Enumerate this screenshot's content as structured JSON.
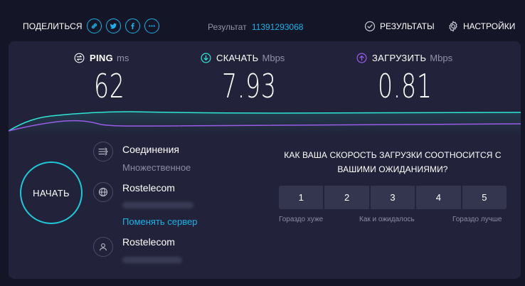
{
  "header": {
    "share_label": "ПОДЕЛИТЬСЯ",
    "share_buttons": [
      "link-icon",
      "twitter-icon",
      "facebook-icon",
      "more-icon"
    ],
    "result_label": "Результат",
    "result_id": "11391293068",
    "results_label": "РЕЗУЛЬТАТЫ",
    "settings_label": "НАСТРОЙКИ"
  },
  "metrics": {
    "ping": {
      "name": "PING",
      "unit": "ms",
      "value": "62",
      "icon": "ping-icon"
    },
    "download": {
      "name": "СКАЧАТЬ",
      "unit": "Mbps",
      "value": "7.93",
      "icon": "download-icon"
    },
    "upload": {
      "name": "ЗАГРУЗИТЬ",
      "unit": "Mbps",
      "value": "0.81",
      "icon": "upload-icon"
    }
  },
  "start_label": "НАЧАТЬ",
  "server": {
    "connections_title": "Соединения",
    "connections_value": "Множественное",
    "isp_name": "Rostelecom",
    "change_server": "Поменять сервер",
    "host_name": "Rostelecom"
  },
  "survey": {
    "question": "КАК ВАША СКОРОСТЬ ЗАГРУЗКИ СООТНОСИТСЯ С ВАШИМИ ОЖИДАНИЯМИ?",
    "options": [
      "1",
      "2",
      "3",
      "4",
      "5"
    ],
    "label_low": "Гораздо хуже",
    "label_mid": "Как и ожидалось",
    "label_high": "Гораздо лучше"
  },
  "colors": {
    "background": "#141526",
    "panel": "#22233a",
    "accent_cyan": "#1ab2e8",
    "download_line": "#2ee6d6",
    "upload_line": "#9a5be8"
  }
}
